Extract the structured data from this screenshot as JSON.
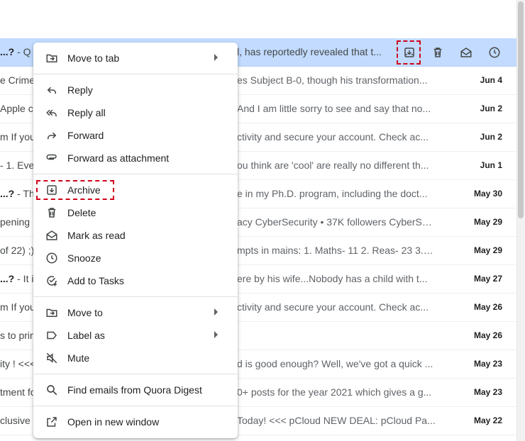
{
  "rows": [
    {
      "left_bold": "...?",
      "left_rest": " - Q",
      "snippet": "l, has reportedly revealed that t...",
      "date": ""
    },
    {
      "left_bold": "",
      "left_rest": "e Crime",
      "snippet": "es Subject B-0, though his transformation...",
      "date": "Jun 4"
    },
    {
      "left_bold": "",
      "left_rest": "Apple c",
      "snippet": "And I am little sorry to see and say that no...",
      "date": "Jun 2"
    },
    {
      "left_bold": "",
      "left_rest": "m If you",
      "snippet": "ctivity and secure your account. Check ac...",
      "date": "Jun 2"
    },
    {
      "left_bold": "",
      "left_rest": " - 1. Eve",
      "snippet": "ou think are 'cool' are really no different th...",
      "date": "Jun 1"
    },
    {
      "left_bold": "...?",
      "left_rest": " - Th",
      "snippet": "e in my Ph.D. program, including the doct...",
      "date": "May 30"
    },
    {
      "left_bold": "",
      "left_rest": "pening",
      "snippet": "acy CyberSecurity • 37K followers CyberSe...",
      "date": "May 29"
    },
    {
      "left_bold": "",
      "left_rest": "of 22) ;)",
      "snippet": "mpts in mains: 1. Maths- 11 2. Reas- 23 3. G...",
      "date": "May 29"
    },
    {
      "left_bold": "...?",
      "left_rest": " - It i",
      "snippet": "ere by his wife...Nobody has a child with t...",
      "date": "May 27"
    },
    {
      "left_bold": "",
      "left_rest": "m If you",
      "snippet": "ctivity and secure your account. Check ac...",
      "date": "May 26"
    },
    {
      "left_bold": "",
      "left_rest": "s to prin",
      "snippet": "",
      "date": "May 26"
    },
    {
      "left_bold": "",
      "left_rest": "ity ! <<<",
      "snippet": "d is good enough? Well, we've got a quick ...",
      "date": "May 23"
    },
    {
      "left_bold": "",
      "left_rest": "tment fo",
      "snippet": "0+ posts for the year 2021 which gives a g...",
      "date": "May 23"
    },
    {
      "left_bold": "",
      "left_rest": "clusive",
      "snippet": "Today! <<< pCloud NEW DEAL: pCloud Pa...",
      "date": "May 22"
    }
  ],
  "row_actions": [
    "archive-icon",
    "delete-icon",
    "mark-as-read-icon",
    "snooze-icon"
  ],
  "menu": {
    "items": [
      {
        "label": "Move to tab",
        "icon": "move-to-tab-icon",
        "submenu": true
      },
      {
        "label": "Reply",
        "icon": "reply-icon"
      },
      {
        "label": "Reply all",
        "icon": "reply-all-icon"
      },
      {
        "label": "Forward",
        "icon": "forward-icon"
      },
      {
        "label": "Forward as attachment",
        "icon": "attachment-icon"
      },
      {
        "label": "Archive",
        "icon": "archive-icon"
      },
      {
        "label": "Delete",
        "icon": "delete-icon"
      },
      {
        "label": "Mark as read",
        "icon": "mark-as-read-icon"
      },
      {
        "label": "Snooze",
        "icon": "snooze-icon"
      },
      {
        "label": "Add to Tasks",
        "icon": "add-to-tasks-icon"
      },
      {
        "label": "Move to",
        "icon": "move-to-icon",
        "submenu": true
      },
      {
        "label": "Label as",
        "icon": "label-icon",
        "submenu": true
      },
      {
        "label": "Mute",
        "icon": "mute-icon"
      },
      {
        "label": "Find emails from Quora Digest",
        "icon": "search-icon"
      },
      {
        "label": "Open in new window",
        "icon": "open-in-new-icon"
      }
    ]
  },
  "colors": {
    "selected_row": "#c2dbff",
    "highlight": "#d0021b"
  }
}
